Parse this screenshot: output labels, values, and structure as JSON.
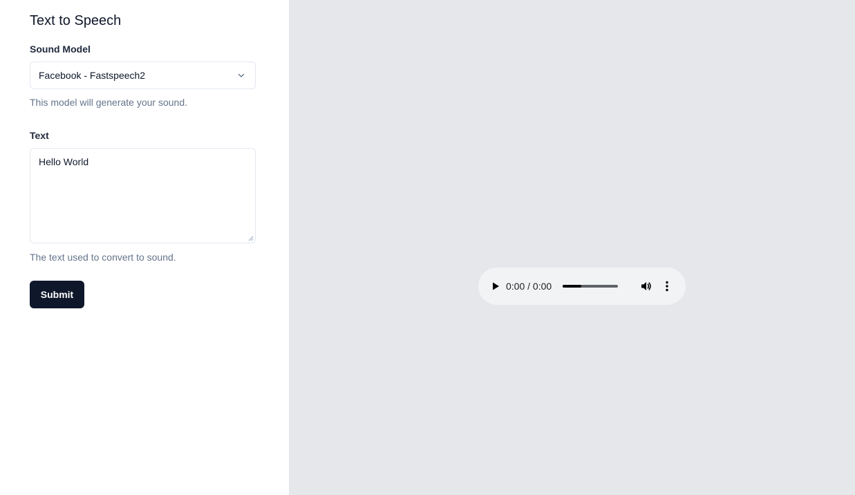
{
  "sidebar": {
    "title": "Text to Speech",
    "model": {
      "label": "Sound Model",
      "selected": "Facebook - Fastspeech2",
      "hint": "This model will generate your sound."
    },
    "text": {
      "label": "Text",
      "value": "Hello World",
      "hint": "The text used to convert to sound."
    },
    "submit_label": "Submit"
  },
  "player": {
    "time": "0:00 / 0:00",
    "progress_fraction": 0.33,
    "icons": {
      "play": "play-icon",
      "volume": "volume-icon",
      "more": "more-options-icon"
    }
  },
  "colors": {
    "primary": "#0f172a",
    "muted_text": "#64748b",
    "main_bg": "#e5e7eb",
    "player_bg": "#f1f3f4"
  }
}
